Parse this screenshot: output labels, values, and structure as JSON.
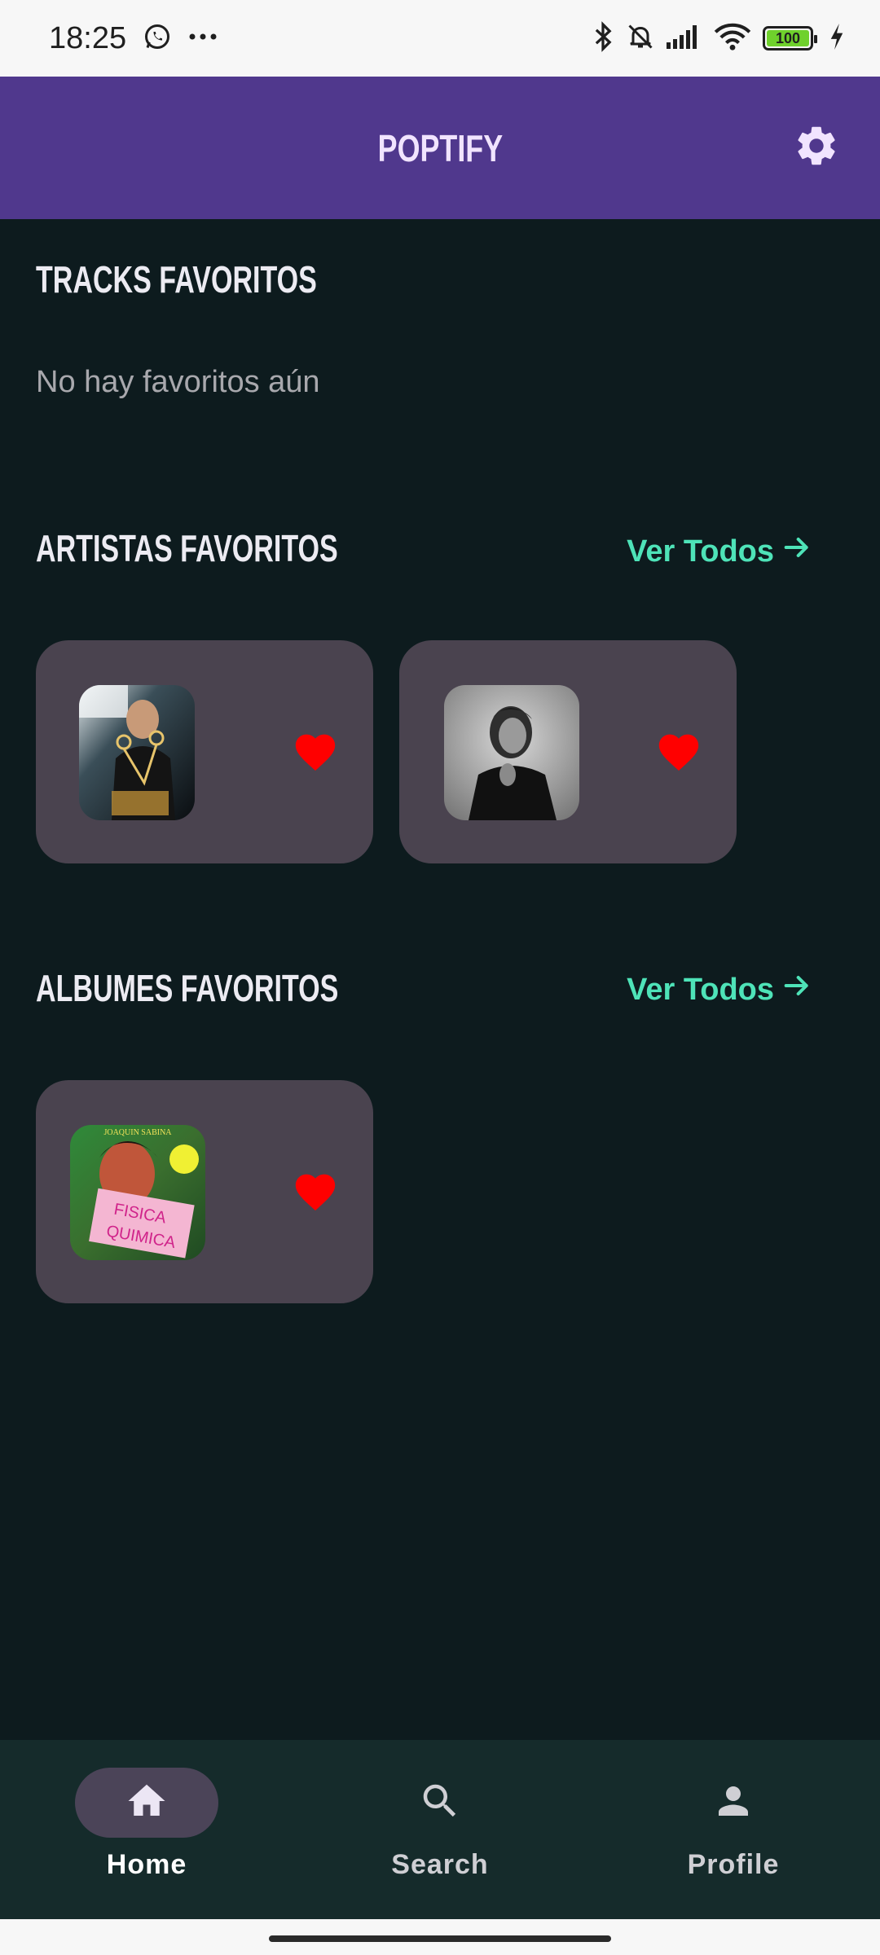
{
  "status_bar": {
    "time": "18:25",
    "battery": "100",
    "icons": [
      "whatsapp-icon",
      "more-icon",
      "bluetooth-icon",
      "bell-off-icon",
      "signal-icon",
      "wifi-icon",
      "battery-icon",
      "charging-icon"
    ]
  },
  "app_bar": {
    "title": "POPTIFY",
    "settings_icon": "gear-icon"
  },
  "sections": {
    "tracks": {
      "title": "TRACKS FAVORITOS",
      "empty_text": "No hay favoritos aún"
    },
    "artists": {
      "title": "ARTISTAS FAVORITOS",
      "see_all": "Ver Todos"
    },
    "albums": {
      "title": "ALBUMES FAVORITOS",
      "see_all": "Ver Todos",
      "album_cover_text": [
        "JOAQUIN SABINA",
        "FISICA",
        "QUIMICA"
      ]
    }
  },
  "bottom_nav": {
    "items": [
      {
        "label": "Home",
        "icon": "home-icon",
        "active": true
      },
      {
        "label": "Search",
        "icon": "search-icon",
        "active": false
      },
      {
        "label": "Profile",
        "icon": "person-icon",
        "active": false
      }
    ]
  },
  "colors": {
    "background": "#0d1b1e",
    "app_bar": "#50388d",
    "accent": "#4ee3b8",
    "card": "#4a434f",
    "heart": "#ff0000",
    "nav_bg": "#152b2b"
  }
}
